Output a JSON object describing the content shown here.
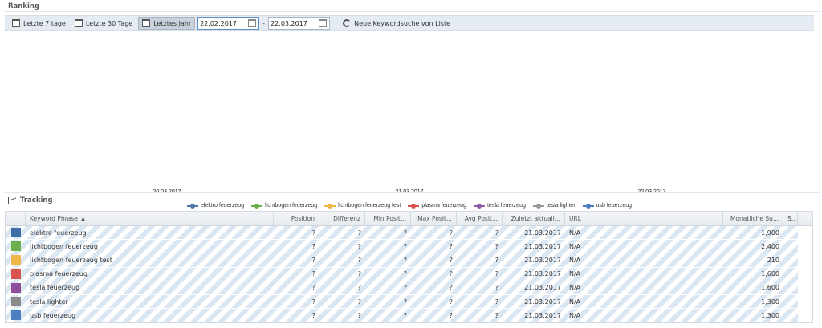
{
  "ranking_title": "Ranking",
  "tracking_title": "Tracking",
  "toolbar": {
    "btn_7": "Letzte 7 tage",
    "btn_30": "Letzte 30 Tage",
    "btn_year": "Letztes Jahr",
    "date_from": "22.02.2017",
    "date_sep": "-",
    "date_to": "22.03.2017",
    "new_search": "Neue Keywordsuche von Liste"
  },
  "chart_data": {
    "type": "line",
    "x": [
      "20.03.2017",
      "21.03.2017",
      "22.03.2017"
    ],
    "series": [
      {
        "name": "elektro feuerzeug",
        "color": "#4e79a7",
        "values": []
      },
      {
        "name": "lichtbogen feuerzeug",
        "color": "#6ab04c",
        "values": []
      },
      {
        "name": "lichtbogen feuerzeug test",
        "color": "#f0b64a",
        "values": []
      },
      {
        "name": "plasma feuerzeug",
        "color": "#d9534f",
        "values": []
      },
      {
        "name": "tesla feuerzeug",
        "color": "#8e5aa5",
        "values": []
      },
      {
        "name": "tesla lighter",
        "color": "#999999",
        "values": []
      },
      {
        "name": "usb feuerzeug",
        "color": "#4a7fbf",
        "values": []
      }
    ],
    "legend_position": "bottom",
    "grid": false
  },
  "table": {
    "columns": {
      "keyword": "Keyword Phrase",
      "position": "Position",
      "diff": "Differenz",
      "min": "Min Posit...",
      "max": "Max Posit...",
      "avg": "Avg Posit...",
      "updated": "Zuletzt aktuali...",
      "url": "URL",
      "monthly": "Monatliche Su...",
      "s": "S..."
    },
    "rows": [
      {
        "color": "#3d6fa6",
        "keyword": "elektro feuerzeug",
        "position": "?",
        "diff": "?",
        "min": "?",
        "max": "?",
        "avg": "?",
        "updated": "21.03.2017",
        "url": "N/A",
        "monthly": "1,900"
      },
      {
        "color": "#6ab04c",
        "keyword": "lichtbogen feuerzeug",
        "position": "?",
        "diff": "?",
        "min": "?",
        "max": "?",
        "avg": "?",
        "updated": "21.03.2017",
        "url": "N/A",
        "monthly": "2,400"
      },
      {
        "color": "#f0b64a",
        "keyword": "lichtbogen feuerzeug test",
        "position": "?",
        "diff": "?",
        "min": "?",
        "max": "?",
        "avg": "?",
        "updated": "21.03.2017",
        "url": "N/A",
        "monthly": "210"
      },
      {
        "color": "#d9534f",
        "keyword": "plasma feuerzeug",
        "position": "?",
        "diff": "?",
        "min": "?",
        "max": "?",
        "avg": "?",
        "updated": "21.03.2017",
        "url": "N/A",
        "monthly": "1,600"
      },
      {
        "color": "#8e4e9a",
        "keyword": "tesla feuerzeug",
        "position": "?",
        "diff": "?",
        "min": "?",
        "max": "?",
        "avg": "?",
        "updated": "21.03.2017",
        "url": "N/A",
        "monthly": "1,600"
      },
      {
        "color": "#8a8a8a",
        "keyword": "tesla lighter",
        "position": "?",
        "diff": "?",
        "min": "?",
        "max": "?",
        "avg": "?",
        "updated": "21.03.2017",
        "url": "N/A",
        "monthly": "1,300"
      },
      {
        "color": "#4a7fbf",
        "keyword": "usb feuerzeug",
        "position": "?",
        "diff": "?",
        "min": "?",
        "max": "?",
        "avg": "?",
        "updated": "21.03.2017",
        "url": "N/A",
        "monthly": "1,300"
      }
    ]
  }
}
